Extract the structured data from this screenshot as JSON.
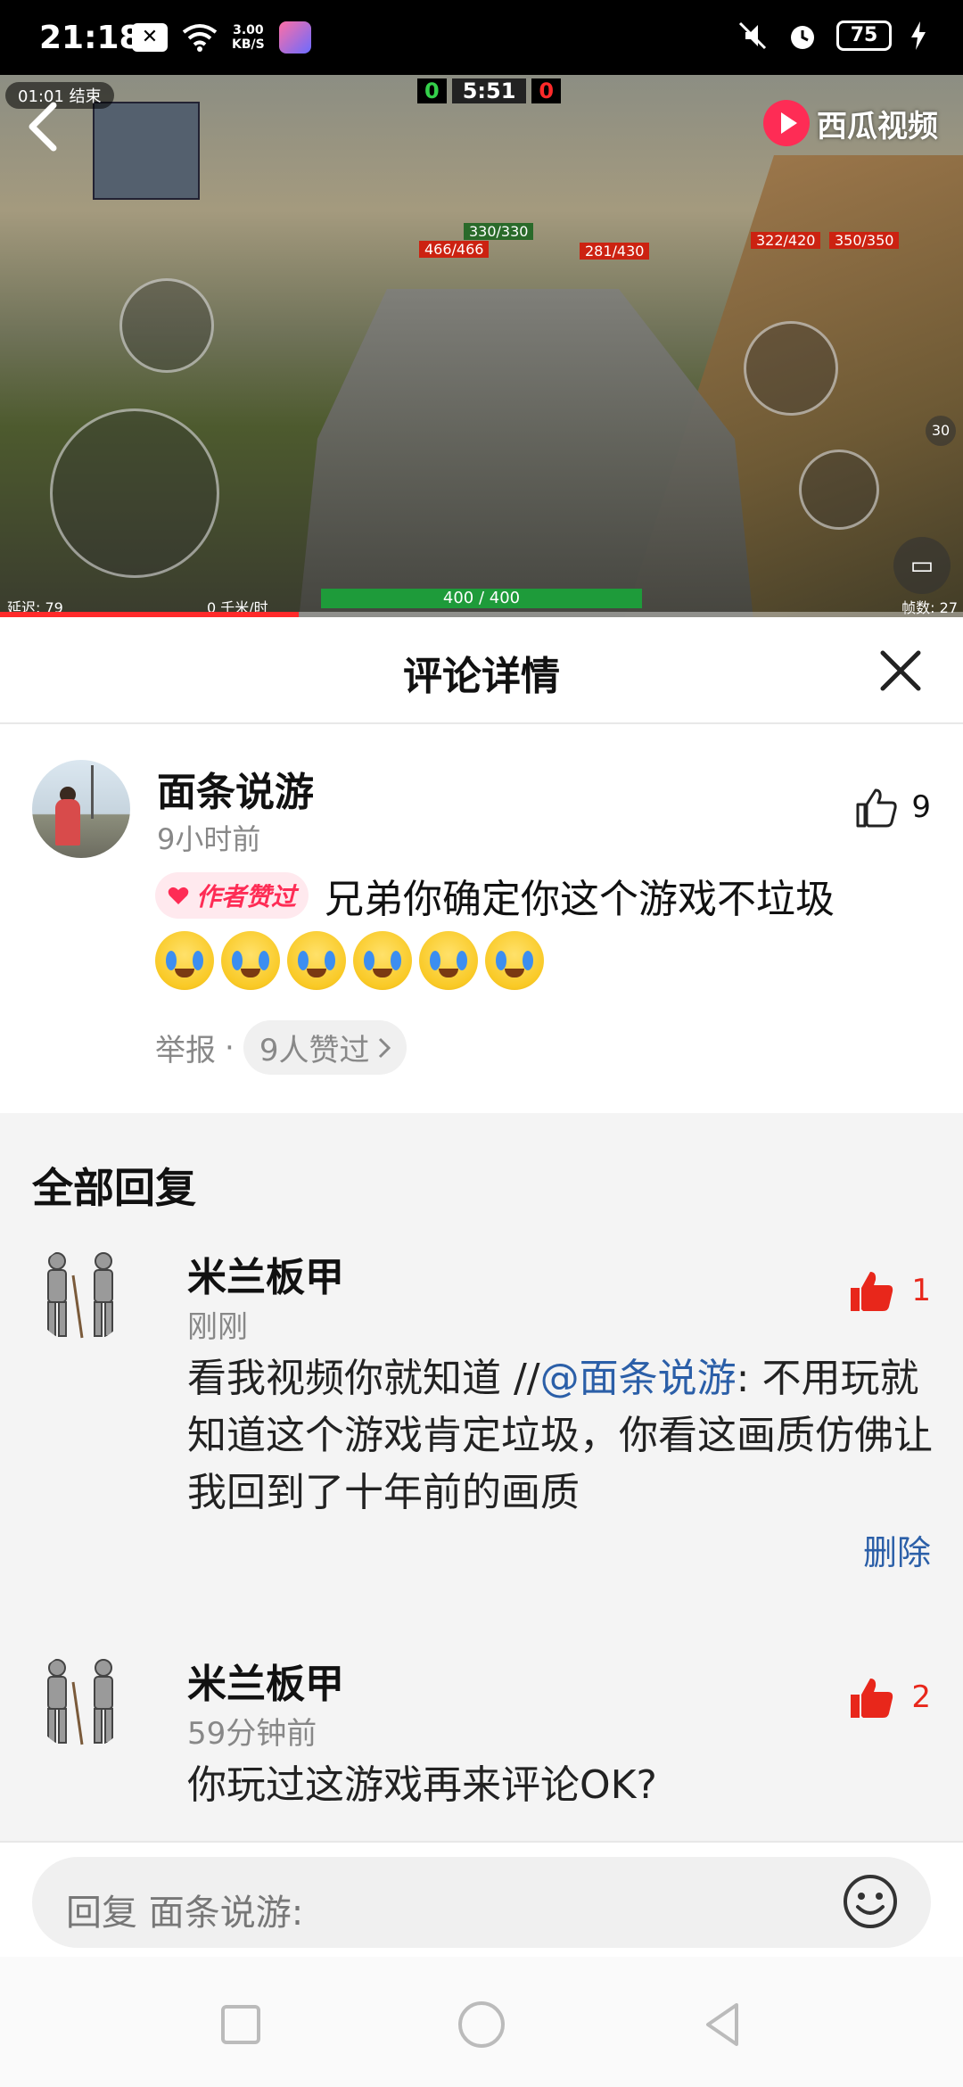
{
  "status_bar": {
    "time": "21:18",
    "net_speed_value": "3.00",
    "net_speed_unit": "KB/S",
    "battery": "75"
  },
  "video": {
    "rec_time": "01:01",
    "rec_end_label": "结束",
    "score_left": "0",
    "match_timer": "5:51",
    "score_right": "0",
    "brand": "西瓜视频",
    "player_hp": "400 / 400",
    "enemy_hp_1": "466/466",
    "ally_hp": "330/330",
    "enemy_hp_2": "281/430",
    "enemy_hp_3": "322/420",
    "enemy_hp_4": "350/350",
    "latency": "延迟: 79",
    "speed": "0 千米/时",
    "fps": "帧数: 27",
    "ammo_count": "30",
    "progress_fraction": 0.31
  },
  "header": {
    "title": "评论详情"
  },
  "main_comment": {
    "author": "面条说游",
    "time": "9小时前",
    "like_count": "9",
    "badge": "作者赞过",
    "text": "兄弟你确定你这个游戏不垃圾",
    "emoji_count": 6,
    "report_label": "举报",
    "separator": "·",
    "likers_label": "9人赞过"
  },
  "replies": {
    "section_title": "全部回复",
    "items": [
      {
        "author": "米兰板甲",
        "time": "刚刚",
        "like_count": "1",
        "text_before": "看我视频你就知道 //",
        "mention": "@面条说游",
        "text_after": ": 不用玩就知道这个游戏肯定垃圾，你看这画质仿佛让我回到了十年前的画质",
        "delete_label": "删除"
      },
      {
        "author": "米兰板甲",
        "time": "59分钟前",
        "like_count": "2",
        "text": "你玩过这游戏再来评论OK?"
      }
    ]
  },
  "input": {
    "placeholder": "回复 面条说游:"
  },
  "colors": {
    "accent": "#fe2c55",
    "like_red": "#e8271b",
    "mention_blue": "#2b5fa8",
    "muted": "#888888"
  },
  "icons": {
    "back": "chevron-left-icon",
    "close": "close-icon",
    "like_outline": "thumbs-up-outline-icon",
    "like_filled": "thumbs-up-filled-icon",
    "emoji": "smiley-icon",
    "nav_recent": "square-icon",
    "nav_home": "circle-icon",
    "nav_back": "triangle-back-icon"
  }
}
